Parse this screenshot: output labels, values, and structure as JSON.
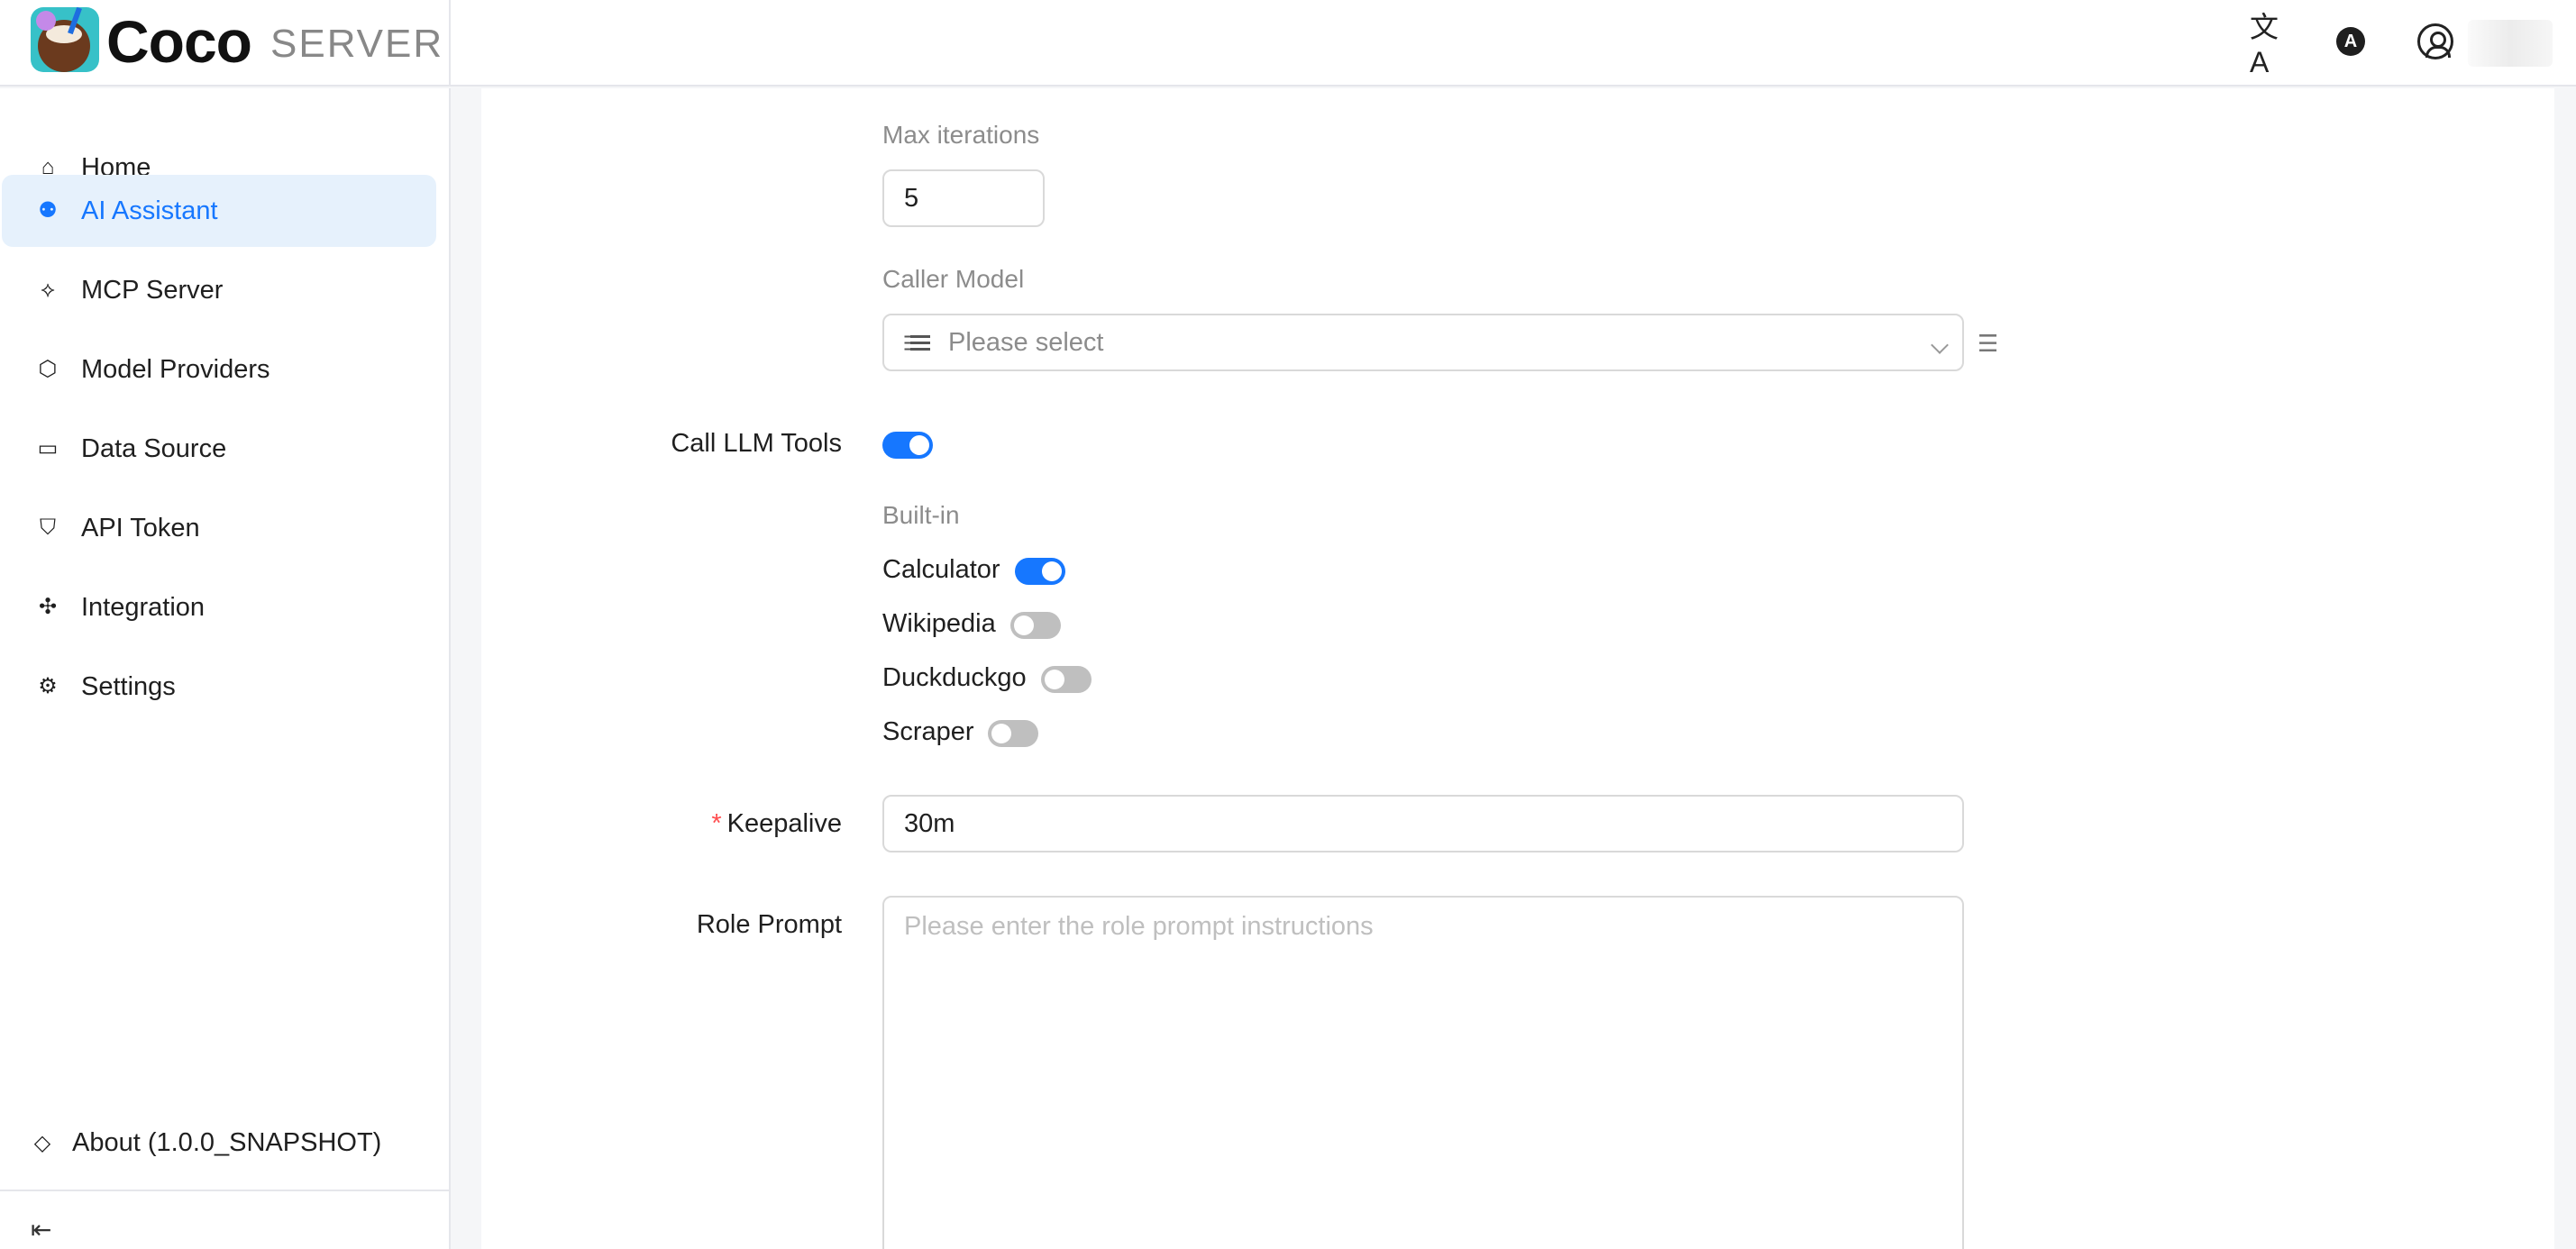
{
  "app": {
    "name": "Coco",
    "subtitle": "SERVER"
  },
  "header": {
    "icons": [
      "translate-icon",
      "theme-icon",
      "user-icon"
    ],
    "theme_letter": "A",
    "translate_glyph": "文A"
  },
  "sidebar": {
    "items": [
      {
        "label": "Home",
        "icon": "home-icon",
        "glyph": "⌂"
      },
      {
        "label": "AI Assistant",
        "icon": "robot-icon",
        "glyph": "⚉"
      },
      {
        "label": "MCP Server",
        "icon": "mcp-icon",
        "glyph": "⟡"
      },
      {
        "label": "Model Providers",
        "icon": "cube-icon",
        "glyph": "⬡"
      },
      {
        "label": "Data Source",
        "icon": "folder-icon",
        "glyph": "▭"
      },
      {
        "label": "API Token",
        "icon": "shield-icon",
        "glyph": "⛉"
      },
      {
        "label": "Integration",
        "icon": "puzzle-icon",
        "glyph": "✣"
      },
      {
        "label": "Settings",
        "icon": "gear-icon",
        "glyph": "⚙"
      }
    ],
    "active_index": 1,
    "about": {
      "label": "About (1.0.0_SNAPSHOT)",
      "icon": "diamond-icon",
      "glyph": "◇"
    },
    "collapse_glyph": "⇤"
  },
  "form": {
    "max_iterations": {
      "label": "Max iterations",
      "value": "5"
    },
    "caller_model": {
      "label": "Caller Model",
      "placeholder": "Please select"
    },
    "call_llm_tools": {
      "label": "Call LLM Tools",
      "enabled": true
    },
    "builtin": {
      "label": "Built-in",
      "tools": [
        {
          "label": "Calculator",
          "enabled": true
        },
        {
          "label": "Wikipedia",
          "enabled": false
        },
        {
          "label": "Duckduckgo",
          "enabled": false
        },
        {
          "label": "Scraper",
          "enabled": false
        }
      ]
    },
    "keepalive": {
      "label": "Keepalive",
      "required": "*",
      "value": "30m"
    },
    "role_prompt": {
      "label": "Role Prompt",
      "placeholder": "Please enter the role prompt instructions"
    }
  },
  "colors": {
    "accent": "#1677ff",
    "active_bg": "#e6f1fc",
    "toggle_off": "#bfbfbf",
    "required": "#ff4d4f"
  }
}
